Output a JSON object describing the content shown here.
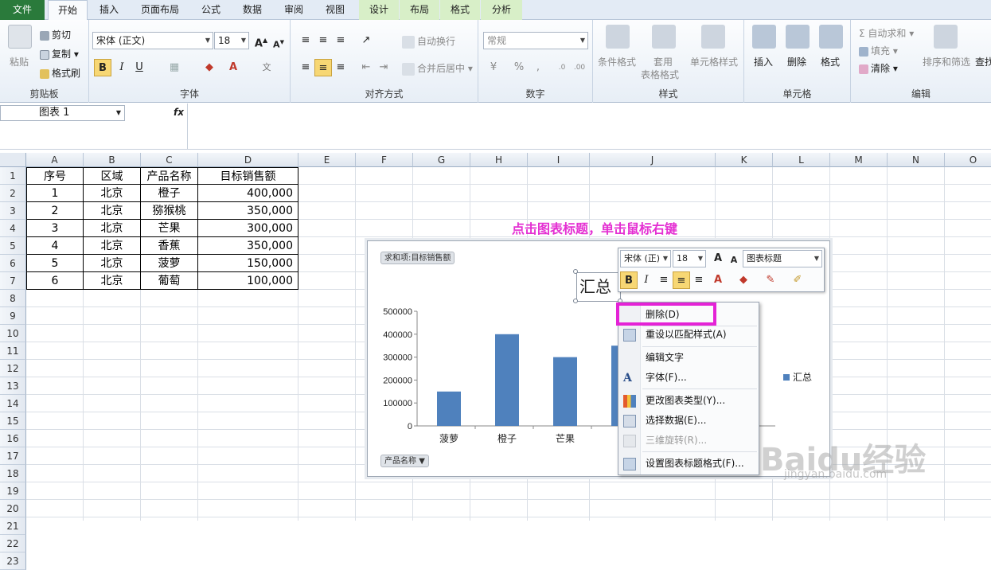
{
  "ribbon_tabs": [
    {
      "label": "文件"
    },
    {
      "label": "开始"
    },
    {
      "label": "插入"
    },
    {
      "label": "页面布局"
    },
    {
      "label": "公式"
    },
    {
      "label": "数据"
    },
    {
      "label": "审阅"
    },
    {
      "label": "视图"
    },
    {
      "label": "设计"
    },
    {
      "label": "布局"
    },
    {
      "label": "格式"
    },
    {
      "label": "分析"
    }
  ],
  "clipboard": {
    "paste": "粘贴",
    "cut": "剪切",
    "copy": "复制",
    "format_painter": "格式刷",
    "label": "剪贴板"
  },
  "font": {
    "name": "宋体 (正文)",
    "size": "18",
    "bold": "B",
    "italic": "I",
    "underline": "U",
    "label": "字体"
  },
  "alignment": {
    "wrap": "自动换行",
    "merge": "合并后居中",
    "label": "对齐方式"
  },
  "number": {
    "format": "常规",
    "percent": "%",
    "comma": ",",
    "label": "数字"
  },
  "styles": {
    "conditional": "条件格式",
    "table_line1": "套用",
    "table_line2": "表格格式",
    "cell_styles": "单元格样式",
    "label": "样式"
  },
  "cells": {
    "insert": "插入",
    "delete": "删除",
    "format": "格式",
    "label": "单元格"
  },
  "editing": {
    "autosum": "自动求和",
    "fill": "填充",
    "clear": "清除",
    "sort": "排序和筛选",
    "find": "查找",
    "label": "编辑"
  },
  "formula_bar": {
    "name_box": "图表 1",
    "fx": "fx"
  },
  "columns": [
    "A",
    "B",
    "C",
    "D",
    "E",
    "F",
    "G",
    "H",
    "I",
    "J",
    "K",
    "L",
    "M",
    "N",
    "O"
  ],
  "rows": [
    "1",
    "2",
    "3",
    "4",
    "5",
    "6",
    "7",
    "8",
    "9",
    "10",
    "11",
    "12",
    "13",
    "14",
    "15",
    "16",
    "17",
    "18",
    "19",
    "20",
    "21",
    "22",
    "23"
  ],
  "table": {
    "headers": [
      "序号",
      "区域",
      "产品名称",
      "目标销售额"
    ],
    "rows": [
      [
        "1",
        "北京",
        "橙子",
        "400,000"
      ],
      [
        "2",
        "北京",
        "猕猴桃",
        "350,000"
      ],
      [
        "3",
        "北京",
        "芒果",
        "300,000"
      ],
      [
        "4",
        "北京",
        "香蕉",
        "350,000"
      ],
      [
        "5",
        "北京",
        "菠萝",
        "150,000"
      ],
      [
        "6",
        "北京",
        "葡萄",
        "100,000"
      ]
    ]
  },
  "annotation": "点击图表标题，单击鼠标右键",
  "chart": {
    "pivot_value_field": "求和项:目标销售额",
    "pivot_axis_field": "产品名称",
    "title": "汇总"
  },
  "chart_data": {
    "type": "bar",
    "title": "汇总",
    "categories": [
      "菠萝",
      "橙子",
      "芒果",
      "猕"
    ],
    "series": [
      {
        "name": "汇总",
        "values": [
          150000,
          400000,
          300000,
          350000
        ]
      }
    ],
    "yticks": [
      "500000",
      "400000",
      "300000",
      "200000",
      "100000",
      "0"
    ],
    "ylim": [
      0,
      500000
    ],
    "legend": "right",
    "bar_color": "#4f81bd"
  },
  "mini_toolbar": {
    "font": "宋体 (正)",
    "size": "18",
    "style": "图表标题"
  },
  "context_menu": [
    {
      "label": "删除(D)",
      "enabled": true
    },
    {
      "label": "重设以匹配样式(A)",
      "enabled": true
    },
    {
      "label": "编辑文字",
      "enabled": true
    },
    {
      "label": "字体(F)...",
      "enabled": true
    },
    {
      "label": "更改图表类型(Y)...",
      "enabled": true
    },
    {
      "label": "选择数据(E)...",
      "enabled": true
    },
    {
      "label": "三维旋转(R)...",
      "enabled": false
    },
    {
      "label": "设置图表标题格式(F)...",
      "enabled": true
    }
  ],
  "watermark": {
    "brand": "Baidu经验",
    "url": "jingyan.baidu.com"
  }
}
